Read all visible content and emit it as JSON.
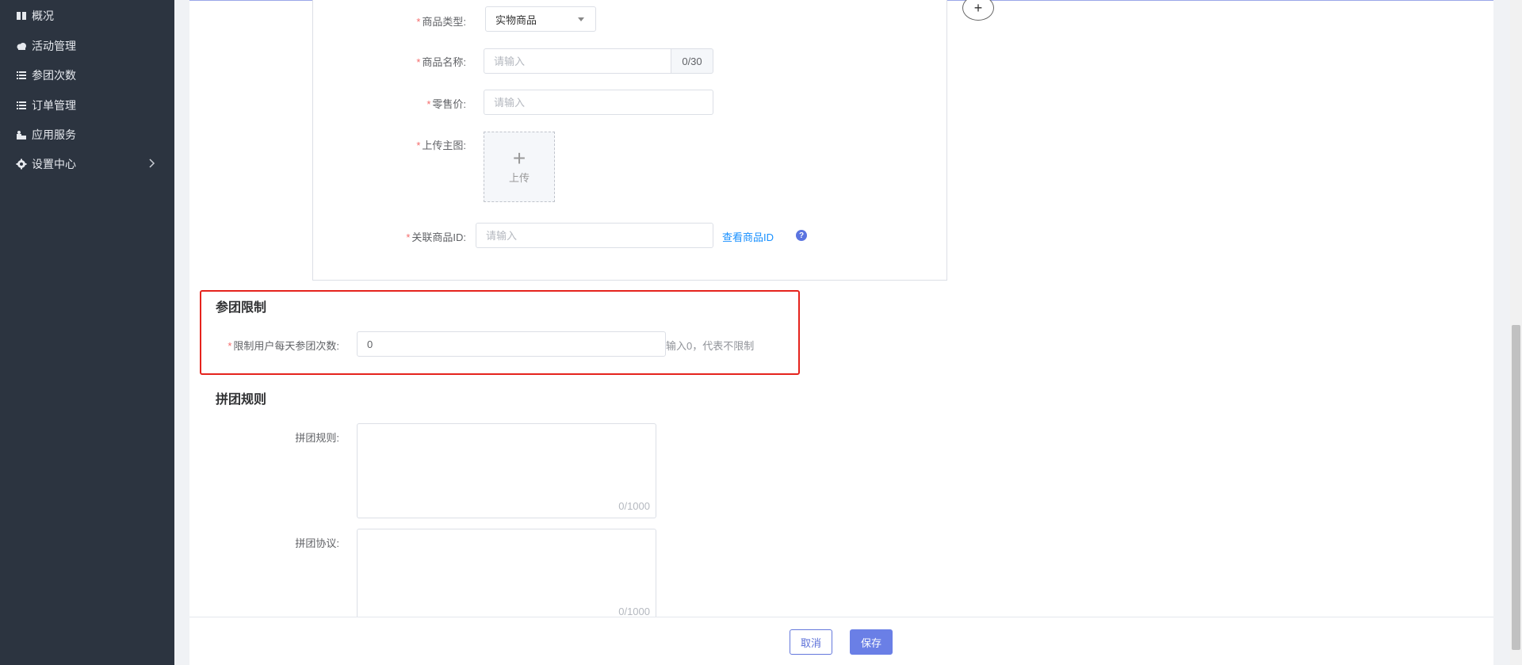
{
  "sidebar": {
    "items": [
      {
        "label": "概况",
        "icon": "book-icon"
      },
      {
        "label": "活动管理",
        "icon": "cloud-icon"
      },
      {
        "label": "参团次数",
        "icon": "list-icon"
      },
      {
        "label": "订单管理",
        "icon": "list-icon"
      },
      {
        "label": "应用服务",
        "icon": "puzzle-icon"
      },
      {
        "label": "设置中心",
        "icon": "gear-icon",
        "has_submenu": true
      }
    ]
  },
  "product": {
    "type_label": "商品类型:",
    "type_value": "实物商品",
    "name_label": "商品名称:",
    "name_placeholder": "请输入",
    "name_counter": "0/30",
    "price_label": "零售价:",
    "price_placeholder": "请输入",
    "image_label": "上传主图:",
    "upload_plus": "+",
    "upload_text": "上传",
    "related_label": "关联商品ID:",
    "related_placeholder": "请输入",
    "view_id_link": "查看商品ID",
    "help_glyph": "?"
  },
  "add_button_glyph": "+",
  "limit_section": {
    "title": "参团限制",
    "daily_label": "限制用户每天参团次数:",
    "daily_value": "0",
    "hint": "输入0，代表不限制"
  },
  "rules_section": {
    "title": "拼团规则",
    "rules_label": "拼团规则:",
    "rules_counter": "0/1000",
    "agreement_label": "拼团协议:",
    "agreement_counter": "0/1000"
  },
  "footer": {
    "cancel_label": "取消",
    "save_label": "保存"
  },
  "colors": {
    "sidebar_bg": "#2c3440",
    "accent": "#6a7fe6",
    "required": "#f56c6c",
    "highlight": "#e5231d",
    "link": "#1890ff"
  }
}
